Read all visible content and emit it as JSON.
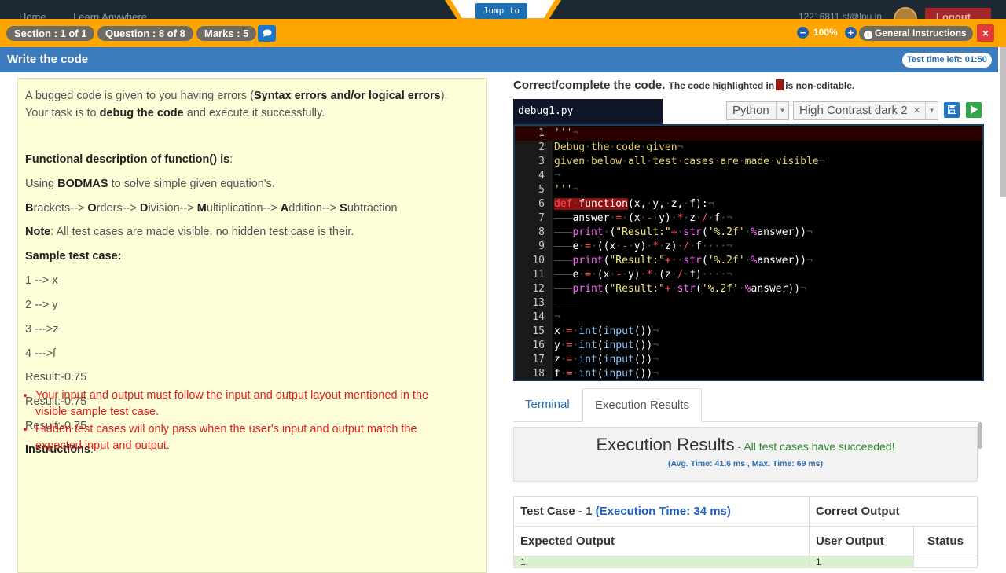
{
  "topnav": {
    "home": "Home",
    "learn": "Learn Anywhere",
    "user": "12216811.st@lpu.in",
    "logout": "Logout"
  },
  "jump_to": "Jump to",
  "header": {
    "section": "Section : 1 of 1",
    "question": "Question : 8 of 8",
    "marks": "Marks : 5",
    "zoom": "100%",
    "general_instructions": "General Instructions",
    "close": "×"
  },
  "subheader": {
    "title": "Write the code",
    "time_left": "Test time left: 01:50"
  },
  "question": {
    "intro_1": "A bugged code is given to you having errors (",
    "intro_bold": "Syntax errors and/or logical errors",
    "intro_2": ").",
    "intro_3": "Your task is to ",
    "intro_bold2": "debug the code",
    "intro_4": " and execute it successfully.",
    "func_heading": "Functional description of function() is",
    "func_colon": ":",
    "using_1": "Using ",
    "using_bold": "BODMAS",
    "using_2": " to solve simple given equation's.",
    "b1": "B",
    "b1r": "rackets--> ",
    "b2": "O",
    "b2r": "rders--> ",
    "b3": "D",
    "b3r": "ivision--> ",
    "b4": "M",
    "b4r": "ultiplication--> ",
    "b5": "A",
    "b5r": "ddition--> ",
    "b6": "S",
    "b6r": "ubtraction",
    "note_bold": "Note",
    "note_text": ": All test cases are made visible, no hidden test case is their.",
    "sample_heading": "Sample test case:",
    "samples": [
      "1 --> x",
      "2 --> y",
      "3 --->z",
      "4 --->f",
      "Result:-0.75",
      "Result:-0.75",
      "Result:-0.75"
    ],
    "instructions_heading": "Instructions",
    "instructions_colon": ":",
    "instructions": [
      "Your input and output must follow the input and output layout mentioned in the visible sample test case.",
      "Hidden test cases will only pass when the user's input and output match the expected input and output."
    ]
  },
  "editor_header": {
    "title": "Correct/complete the code.",
    "note_1": "The code highlighted in",
    "note_2": "is non-editable.",
    "filename": "debug1.py",
    "language": "Python",
    "theme": "High Contrast dark 2",
    "theme_clear": "×"
  },
  "code_lines": [
    {
      "n": "1"
    },
    {
      "n": "2"
    },
    {
      "n": "3"
    },
    {
      "n": "4"
    },
    {
      "n": "5"
    },
    {
      "n": "6"
    },
    {
      "n": "7"
    },
    {
      "n": "8"
    },
    {
      "n": "9"
    },
    {
      "n": "10"
    },
    {
      "n": "11"
    },
    {
      "n": "12"
    },
    {
      "n": "13"
    },
    {
      "n": "14"
    },
    {
      "n": "15"
    },
    {
      "n": "16"
    },
    {
      "n": "17"
    },
    {
      "n": "18"
    }
  ],
  "tabs": {
    "terminal": "Terminal",
    "execution": "Execution Results"
  },
  "execution": {
    "title": "Execution Results",
    "status": " - All test cases have succeeded!",
    "timing": "(Avg. Time: 41.6 ms , Max. Time: 69 ms)"
  },
  "results_table": {
    "testcase": "Test Case - 1",
    "exec_time": "(Execution Time: 34 ms)",
    "correct_output": "Correct Output",
    "expected_output": "Expected Output",
    "user_output": "User Output",
    "status": "Status",
    "expected_first": "1",
    "user_first": "1"
  }
}
